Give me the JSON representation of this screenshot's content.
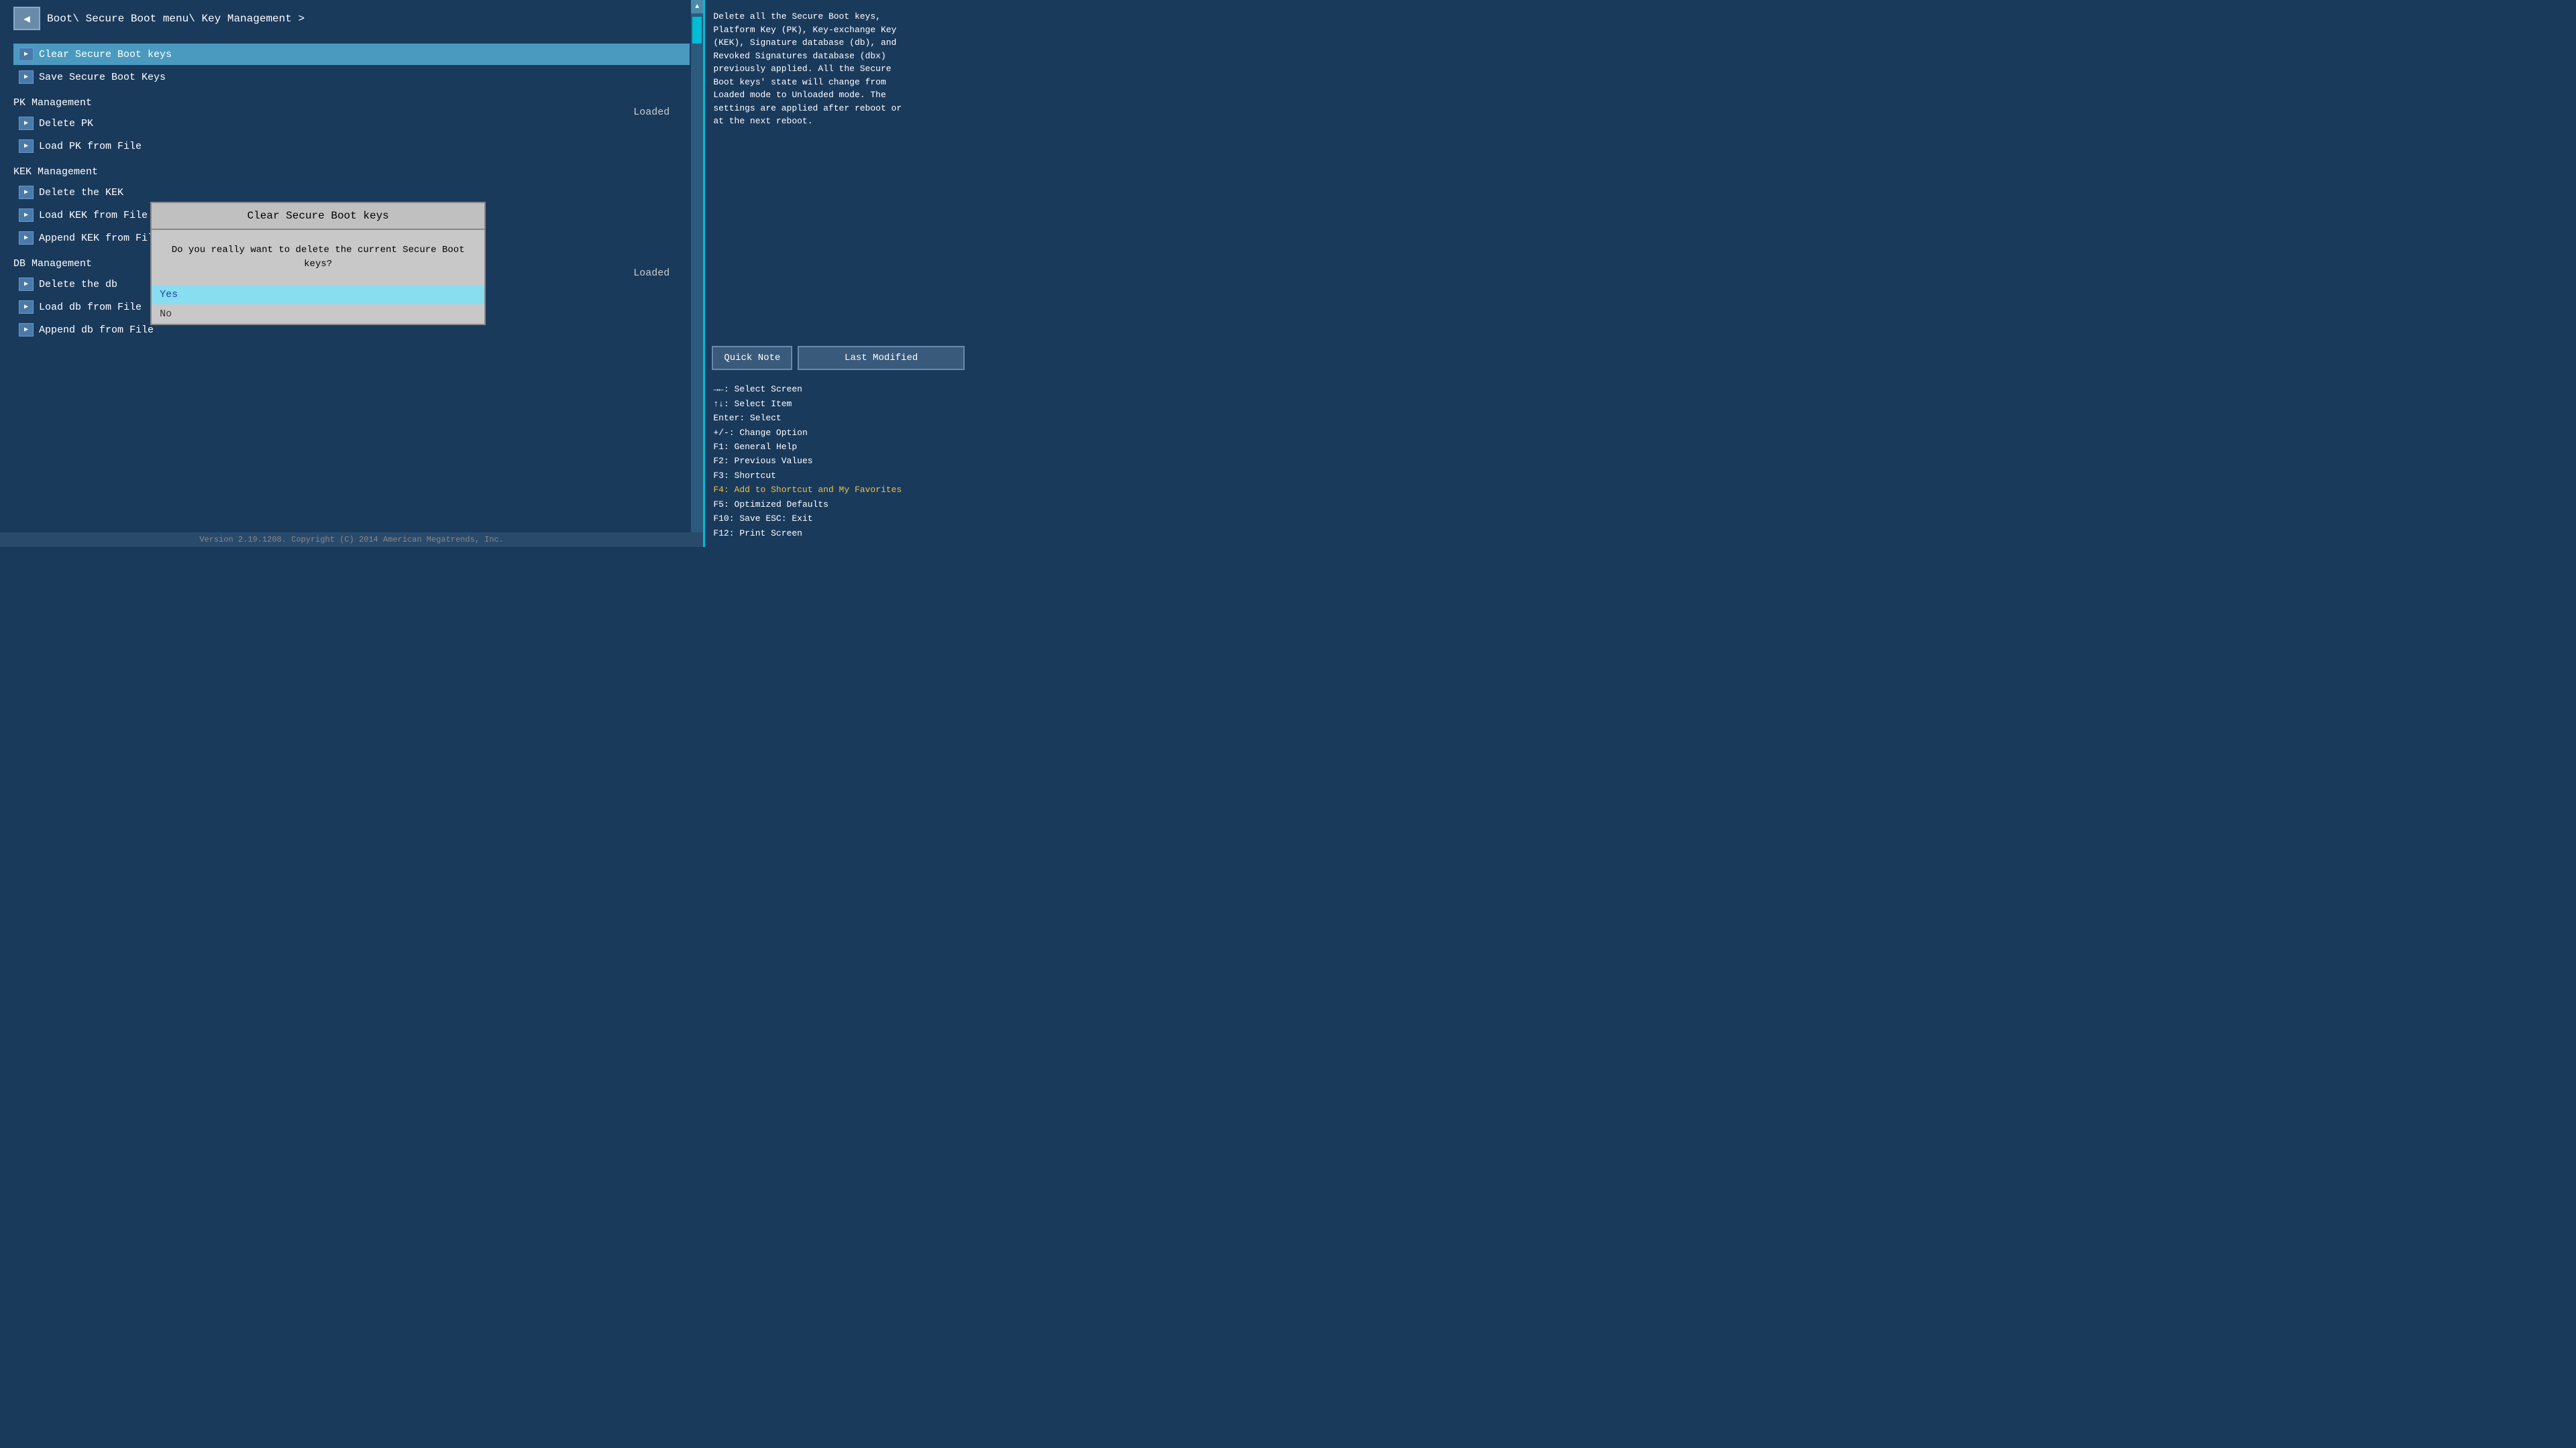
{
  "breadcrumb": {
    "text": "Boot\\ Secure Boot menu\\ Key Management >"
  },
  "menu": {
    "items": [
      {
        "id": "clear-secure-boot-keys",
        "label": "Clear Secure Boot keys",
        "selected": true,
        "hasIcon": true
      },
      {
        "id": "save-secure-boot-keys",
        "label": "Save Secure Boot Keys",
        "selected": false,
        "hasIcon": true
      }
    ],
    "sections": [
      {
        "id": "pk-management",
        "label": "PK Management",
        "status": "Loaded",
        "items": [
          {
            "id": "delete-pk",
            "label": "Delete PK",
            "hasIcon": true
          },
          {
            "id": "load-pk-from-file",
            "label": "Load PK from File",
            "hasIcon": true
          }
        ]
      },
      {
        "id": "kek-management",
        "label": "KEK Management",
        "status": "",
        "items": [
          {
            "id": "delete-the-kek",
            "label": "Delete the KEK",
            "hasIcon": true
          },
          {
            "id": "load-kek-from-file",
            "label": "Load KEK from File",
            "hasIcon": true
          },
          {
            "id": "append-kek-from-file",
            "label": "Append KEK from File",
            "hasIcon": true
          }
        ]
      },
      {
        "id": "db-management",
        "label": "DB Management",
        "status": "Loaded",
        "items": [
          {
            "id": "delete-the-db",
            "label": "Delete the db",
            "hasIcon": true
          },
          {
            "id": "load-db-from-file",
            "label": "Load db from File",
            "hasIcon": true
          },
          {
            "id": "append-db-from-file",
            "label": "Append db from File",
            "hasIcon": true
          }
        ]
      }
    ]
  },
  "right_panel": {
    "help_text": "Delete all the Secure Boot keys,\nPlatform Key (PK), Key-exchange Key\n(KEK), Signature database (db), and\nRevoked Signatures database (dbx)\npreviously applied. All the Secure\nBoot keys' state will change from\nLoaded mode to Unloaded mode. The\nsettings are applied after reboot or\nat the next  reboot.",
    "buttons": {
      "quick_note": "Quick Note",
      "last_modified": "Last Modified"
    },
    "nav_help": [
      {
        "key": "→←:",
        "desc": "Select Screen",
        "highlight": false
      },
      {
        "key": "↑↓:",
        "desc": "Select Item",
        "highlight": false
      },
      {
        "key": "Enter:",
        "desc": "Select",
        "highlight": false
      },
      {
        "key": "+/-:",
        "desc": "Change Option",
        "highlight": false
      },
      {
        "key": "F1:",
        "desc": "General Help",
        "highlight": false
      },
      {
        "key": "F2:",
        "desc": "Previous Values",
        "highlight": false
      },
      {
        "key": "F3:",
        "desc": "Shortcut",
        "highlight": false
      },
      {
        "key": "F4:",
        "desc": "Add to Shortcut and My Favorites",
        "highlight": true
      },
      {
        "key": "F5:",
        "desc": "Optimized Defaults",
        "highlight": false
      },
      {
        "key": "F10:",
        "desc": "Save  ESC: Exit",
        "highlight": false
      },
      {
        "key": "F12:",
        "desc": "Print Screen",
        "highlight": false
      }
    ]
  },
  "modal": {
    "title": "Clear Secure Boot keys",
    "body": "Do you really want to delete the current\nSecure Boot keys?",
    "options": [
      {
        "id": "yes",
        "label": "Yes",
        "selected": true
      },
      {
        "id": "no",
        "label": "No",
        "selected": false
      }
    ]
  },
  "footer": {
    "text": "Version 2.19.1208. Copyright (C) 2014 American Megatrends, Inc."
  }
}
